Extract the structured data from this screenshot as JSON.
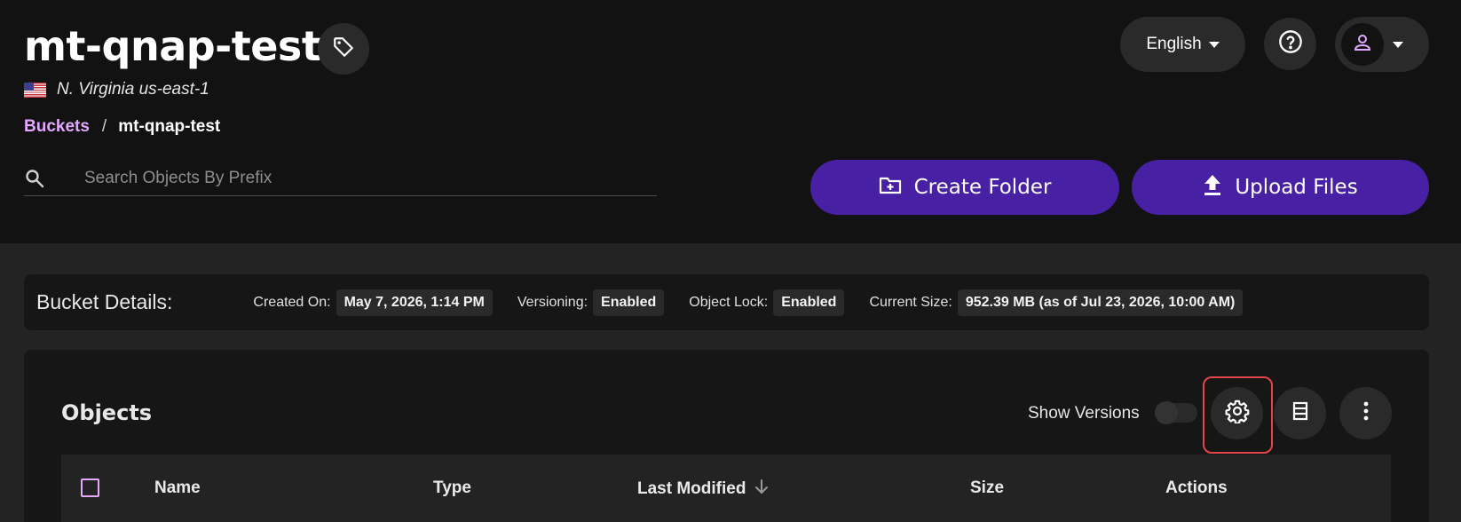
{
  "bucket": {
    "name": "mt-qnap-test",
    "region": "N. Virginia us-east-1"
  },
  "breadcrumb": {
    "root": "Buckets",
    "separator": "/",
    "current": "mt-qnap-test"
  },
  "search": {
    "placeholder": "Search Objects By Prefix",
    "value": ""
  },
  "topbar": {
    "language": "English"
  },
  "actions": {
    "create_folder": "Create Folder",
    "upload_files": "Upload Files"
  },
  "details": {
    "title": "Bucket Details:",
    "created_label": "Created On:",
    "created_value": "May 7, 2026, 1:14 PM",
    "versioning_label": "Versioning:",
    "versioning_value": "Enabled",
    "lock_label": "Object Lock:",
    "lock_value": "Enabled",
    "size_label": "Current Size:",
    "size_value": "952.39 MB (as of Jul 23, 2026, 10:00 AM)"
  },
  "objects": {
    "title": "Objects",
    "show_versions_label": "Show Versions",
    "show_versions_on": false,
    "columns": [
      "Name",
      "Type",
      "Last Modified",
      "Size",
      "Actions"
    ],
    "sort_column": "Last Modified",
    "sort_direction": "descending"
  },
  "colors": {
    "accent": "#4820a3",
    "link": "#e3a8ff",
    "highlight": "#e2464a",
    "background": "#121212"
  },
  "icons": [
    "tag-icon",
    "help-icon",
    "user-icon",
    "search-icon",
    "folder-plus-icon",
    "upload-icon",
    "gear-icon",
    "columns-icon",
    "more-vertical-icon",
    "sort-arrow-down-icon"
  ]
}
